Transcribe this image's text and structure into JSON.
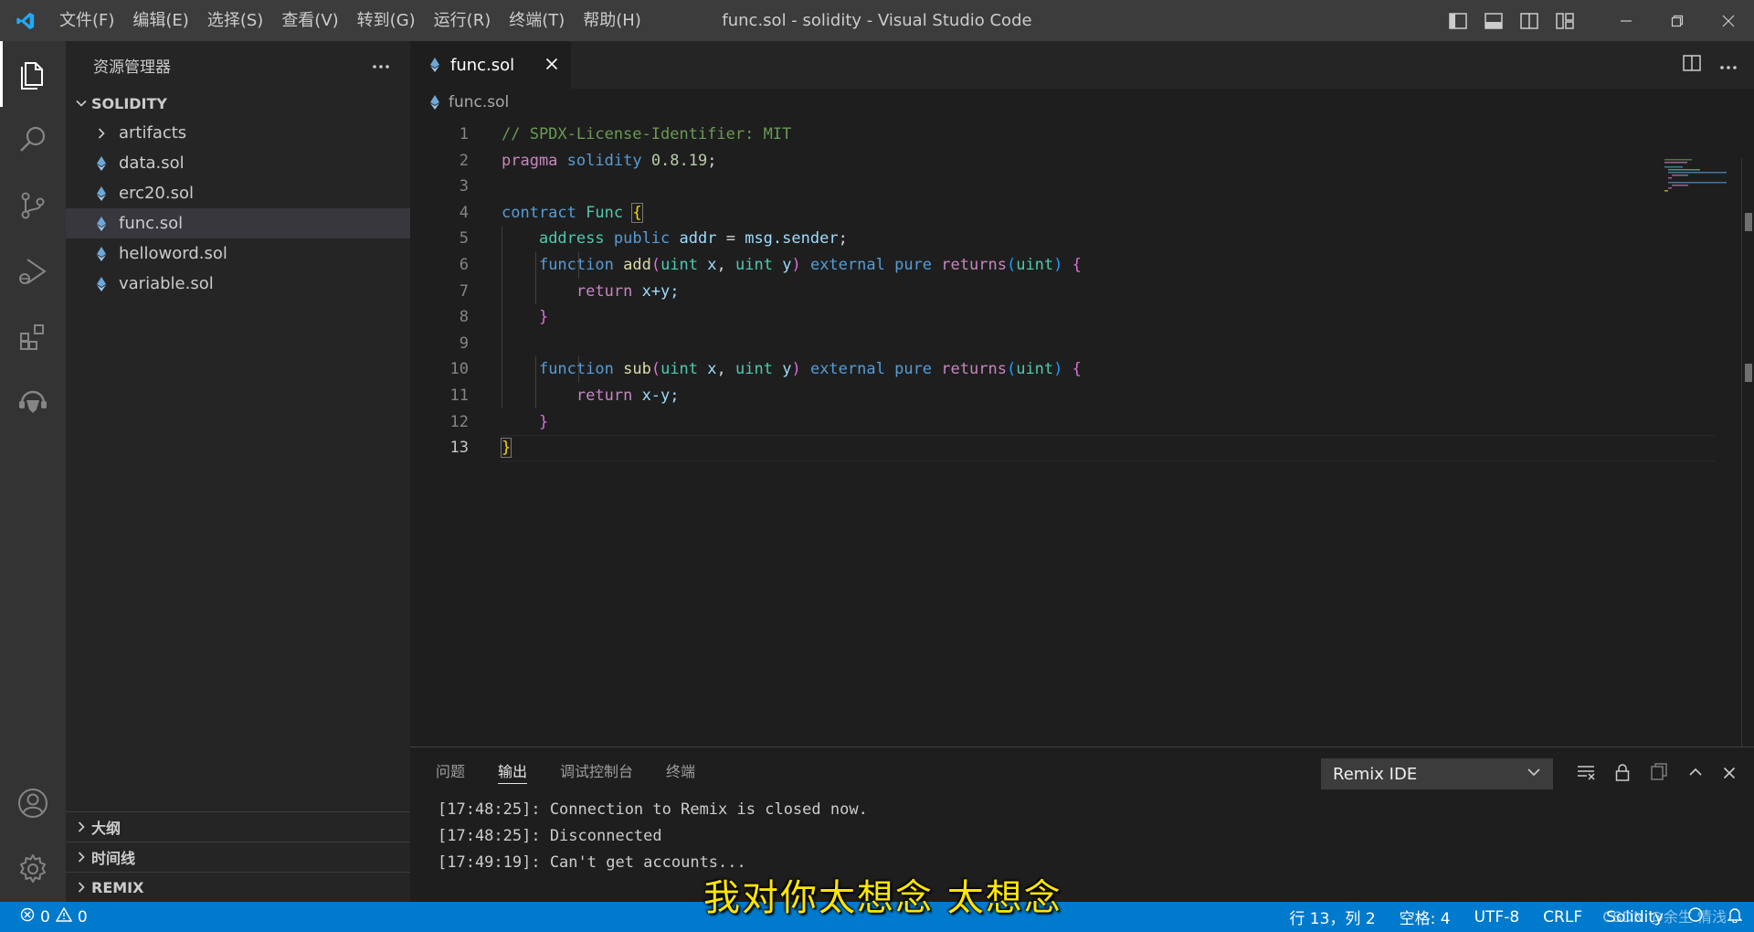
{
  "titlebar": {
    "menu": [
      "文件(F)",
      "编辑(E)",
      "选择(S)",
      "查看(V)",
      "转到(G)",
      "运行(R)",
      "终端(T)",
      "帮助(H)"
    ],
    "window_title": "func.sol - solidity - Visual Studio Code"
  },
  "sidebar": {
    "title": "资源管理器",
    "folder": "SOLIDITY",
    "items": [
      {
        "label": "artifacts",
        "type": "folder"
      },
      {
        "label": "data.sol",
        "type": "file"
      },
      {
        "label": "erc20.sol",
        "type": "file"
      },
      {
        "label": "func.sol",
        "type": "file",
        "selected": true
      },
      {
        "label": "helloword.sol",
        "type": "file"
      },
      {
        "label": "variable.sol",
        "type": "file"
      }
    ],
    "bottom_sections": [
      "大纲",
      "时间线",
      "REMIX"
    ]
  },
  "editor": {
    "tab_label": "func.sol",
    "breadcrumb": "func.sol",
    "line_numbers": [
      "1",
      "2",
      "3",
      "4",
      "5",
      "6",
      "7",
      "8",
      "9",
      "10",
      "11",
      "12",
      "13"
    ],
    "current_line": "13",
    "code": {
      "l1": "// SPDX-License-Identifier: MIT",
      "l2_kw": "pragma",
      "l2_name": "solidity",
      "l2_ver": "0.8.19",
      "l2_end": ";",
      "l4_kw": "contract",
      "l4_name": "Func",
      "l5_type": "address",
      "l5_vis": "public",
      "l5_var": "addr",
      "l5_eq": " = ",
      "l5_msg": "msg.sender",
      "l5_end": ";",
      "fn_kw": "function",
      "fn_add": "add",
      "fn_sub": "sub",
      "uint": "uint",
      "param_x": "x",
      "param_y": "y",
      "external": "external",
      "pure": "pure",
      "returns": "returns",
      "return_kw": "return",
      "l7_expr": "x+y;",
      "l11_expr": "x-y;",
      "brace_open": "{",
      "brace_close": "}",
      "paren_open": "(",
      "paren_close": ")",
      "comma": ", "
    }
  },
  "panel": {
    "tabs": [
      "问题",
      "输出",
      "调试控制台",
      "终端"
    ],
    "active_tab": "输出",
    "channel": "Remix IDE",
    "output_lines": [
      "[17:48:25]: Connection to Remix is closed now.",
      "[17:48:25]: Disconnected",
      "[17:49:19]: Can't get accounts..."
    ]
  },
  "statusbar": {
    "errors": "0",
    "warnings": "0",
    "position": "行 13，列 2",
    "indent": "空格: 4",
    "encoding": "UTF-8",
    "eol": "CRLF",
    "language": "Solidity"
  },
  "overlay": {
    "subtitle": "我对你太想念 太想念",
    "watermark": "CSDN @余生 情浅"
  },
  "colors": {
    "accent": "#007acc",
    "comment": "#6a9955",
    "keyword": "#c586c0",
    "keyword_blue": "#569cd6",
    "type": "#4ec9b0",
    "function": "#dcdcaa"
  }
}
